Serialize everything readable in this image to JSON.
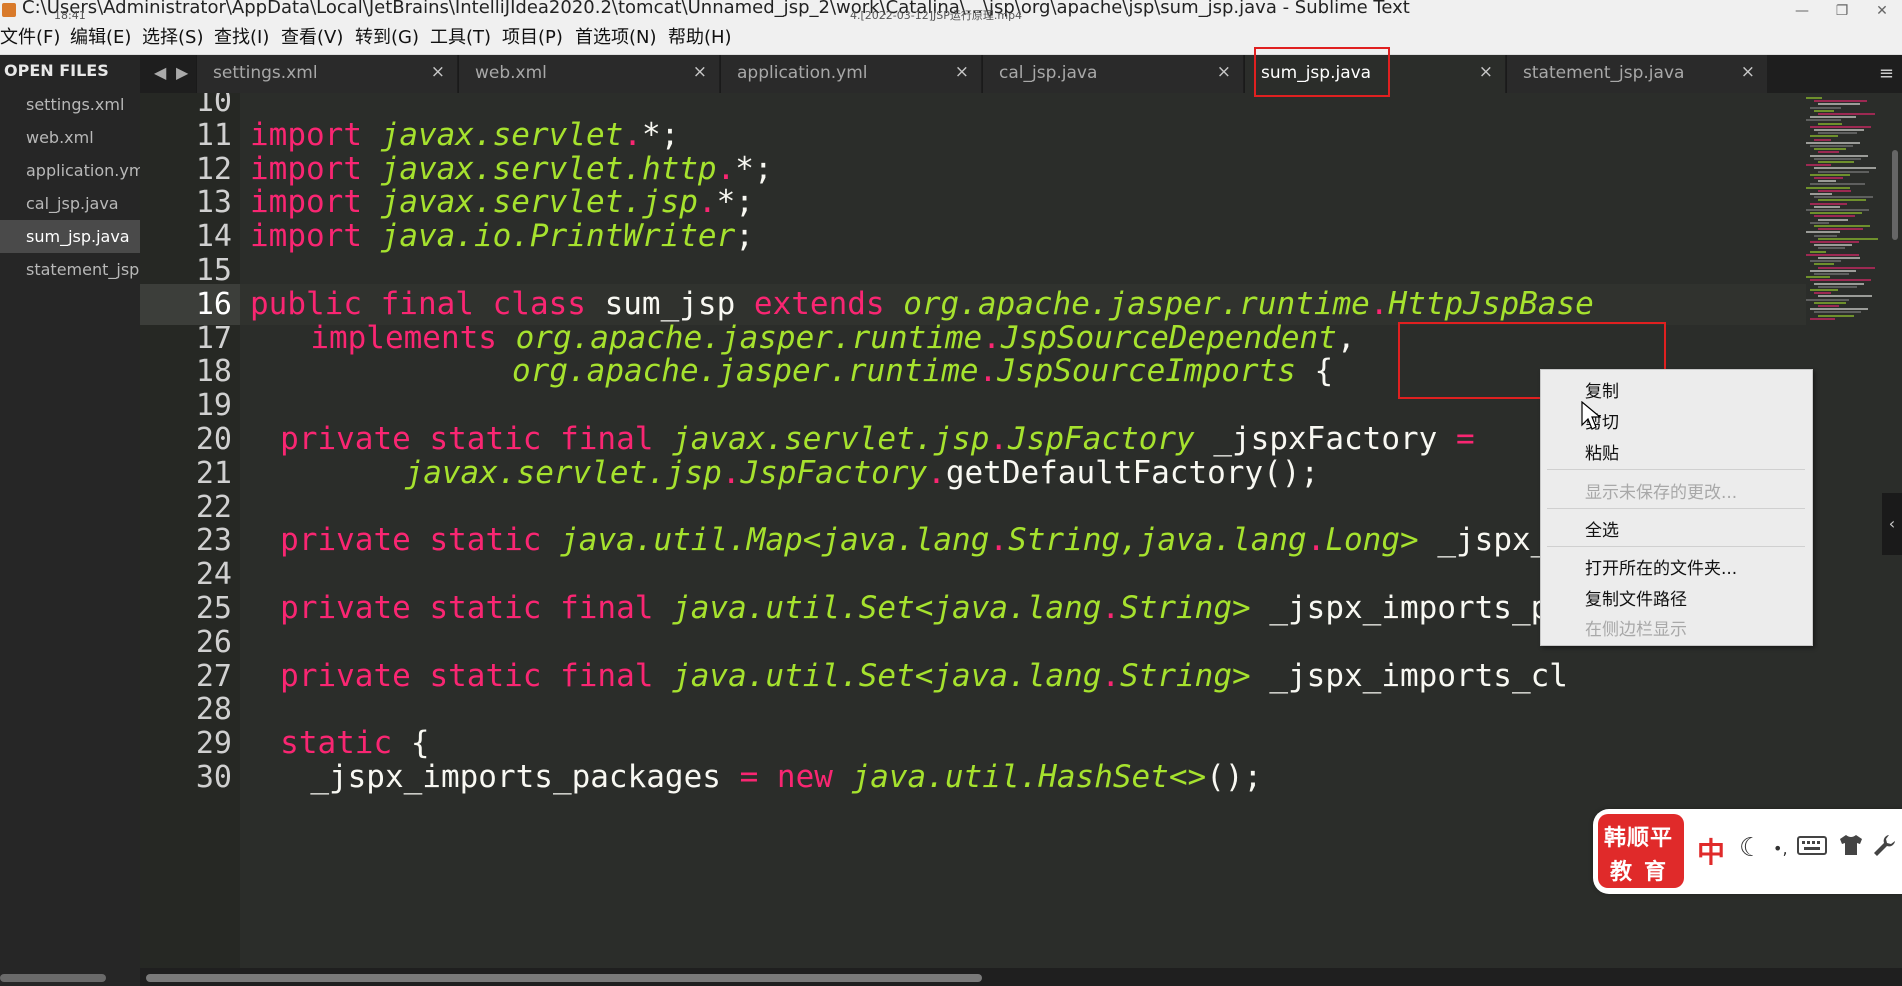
{
  "window": {
    "title": "C:\\Users\\Administrator\\AppData\\Local\\JetBrains\\IntelliJIdea2020.2\\tomcat\\Unnamed_jsp_2\\work\\Catalina\\...\\jsp\\org\\apache\\jsp\\sum_jsp.java - Sublime Text",
    "time_overlay": "18:41",
    "video_overlay": "4.[2022-03-12]JSP运行原理.mp4",
    "controls": [
      "—",
      "❐",
      "✕"
    ]
  },
  "menu": [
    {
      "label": "文件(F)"
    },
    {
      "label": "编辑(E)"
    },
    {
      "label": "选择(S)"
    },
    {
      "label": "查找(I)"
    },
    {
      "label": "查看(V)"
    },
    {
      "label": "转到(G)"
    },
    {
      "label": "工具(T)"
    },
    {
      "label": "项目(P)"
    },
    {
      "label": "首选项(N)"
    },
    {
      "label": "帮助(H)"
    }
  ],
  "sidebar": {
    "header": "OPEN FILES",
    "files": [
      {
        "label": "settings.xml",
        "selected": false
      },
      {
        "label": "web.xml",
        "selected": false
      },
      {
        "label": "application.yml",
        "selected": false
      },
      {
        "label": "cal_jsp.java",
        "selected": false
      },
      {
        "label": "sum_jsp.java",
        "selected": true
      },
      {
        "label": "statement_jsp.java",
        "selected": false
      }
    ]
  },
  "tabs": [
    {
      "label": "settings.xml",
      "close": "×",
      "active": false
    },
    {
      "label": "web.xml",
      "close": "×",
      "active": false
    },
    {
      "label": "application.yml",
      "close": "×",
      "active": false
    },
    {
      "label": "cal_jsp.java",
      "close": "×",
      "active": false
    },
    {
      "label": "sum_jsp.java",
      "close": "×",
      "active": true
    },
    {
      "label": "statement_jsp.java",
      "close": "×",
      "active": false
    }
  ],
  "tab_nav": {
    "prev": "◀",
    "next": "▶",
    "menu": "≡"
  },
  "editor": {
    "current_line": 16,
    "lines": [
      {
        "n": "10",
        "t": [],
        "indent": 0
      },
      {
        "n": "11",
        "t": [
          [
            "kw",
            "import "
          ],
          [
            "ty",
            "javax.servlet"
          ],
          [
            "op",
            "."
          ],
          [
            "pl",
            "*;"
          ]
        ],
        "indent": 0
      },
      {
        "n": "12",
        "t": [
          [
            "kw",
            "import "
          ],
          [
            "ty",
            "javax.servlet.http"
          ],
          [
            "op",
            "."
          ],
          [
            "pl",
            "*;"
          ]
        ],
        "indent": 0
      },
      {
        "n": "13",
        "t": [
          [
            "kw",
            "import "
          ],
          [
            "ty",
            "javax.servlet.jsp"
          ],
          [
            "op",
            "."
          ],
          [
            "pl",
            "*;"
          ]
        ],
        "indent": 0
      },
      {
        "n": "14",
        "t": [
          [
            "kw",
            "import "
          ],
          [
            "ty",
            "java.io.PrintWriter"
          ],
          [
            "pl",
            ";"
          ]
        ],
        "indent": 0
      },
      {
        "n": "15",
        "t": [],
        "indent": 0
      },
      {
        "n": "16",
        "t": [
          [
            "kw",
            "public final class "
          ],
          [
            "pl",
            "sum_jsp "
          ],
          [
            "kw",
            "extends "
          ],
          [
            "ty",
            "org.apache.jasper.runtime"
          ],
          [
            "op",
            "."
          ],
          [
            "ty",
            "HttpJspBase"
          ]
        ],
        "indent": 0
      },
      {
        "n": "17",
        "t": [
          [
            "kw",
            "implements "
          ],
          [
            "ty",
            "org.apache.jasper.runtime"
          ],
          [
            "op",
            "."
          ],
          [
            "ty",
            "JspSourceDependent"
          ],
          [
            "pl",
            ","
          ]
        ],
        "indent": 2
      },
      {
        "n": "18",
        "t": [
          [
            "ty",
            "org.apache.jasper.runtime"
          ],
          [
            "op",
            "."
          ],
          [
            "ty",
            "JspSourceImports "
          ],
          [
            "pl",
            "{"
          ]
        ],
        "indent": 8
      },
      {
        "n": "19",
        "t": [],
        "indent": 0
      },
      {
        "n": "20",
        "t": [
          [
            "kw",
            "private static final "
          ],
          [
            "ty",
            "javax.servlet.jsp"
          ],
          [
            "op",
            "."
          ],
          [
            "ty",
            "JspFactory "
          ],
          [
            "pl",
            "_jspxFactory "
          ],
          [
            "op",
            "="
          ]
        ],
        "indent": 1
      },
      {
        "n": "21",
        "t": [
          [
            "ty",
            "javax.servlet.jsp"
          ],
          [
            "op",
            "."
          ],
          [
            "ty",
            "JspFactory"
          ],
          [
            "op",
            "."
          ],
          [
            "pl",
            "getDefaultFactory();"
          ]
        ],
        "indent": 5
      },
      {
        "n": "22",
        "t": [],
        "indent": 0
      },
      {
        "n": "23",
        "t": [
          [
            "kw",
            "private static "
          ],
          [
            "ty",
            "java.util.Map<java.lang"
          ],
          [
            "op",
            "."
          ],
          [
            "ty",
            "String,java.lang"
          ],
          [
            "op",
            "."
          ],
          [
            "ty",
            "Long> "
          ],
          [
            "pl",
            "_jspx_dependants;"
          ]
        ],
        "indent": 1
      },
      {
        "n": "24",
        "t": [],
        "indent": 0
      },
      {
        "n": "25",
        "t": [
          [
            "kw",
            "private static final "
          ],
          [
            "ty",
            "java.util.Set<java.lang"
          ],
          [
            "op",
            "."
          ],
          [
            "ty",
            "String> "
          ],
          [
            "pl",
            "_jspx_imports_packages;"
          ]
        ],
        "indent": 1
      },
      {
        "n": "26",
        "t": [],
        "indent": 0
      },
      {
        "n": "27",
        "t": [
          [
            "kw",
            "private static final "
          ],
          [
            "ty",
            "java.util.Set<java.lang"
          ],
          [
            "op",
            "."
          ],
          [
            "ty",
            "String> "
          ],
          [
            "pl",
            "_jspx_imports_cl"
          ]
        ],
        "indent": 1
      },
      {
        "n": "28",
        "t": [],
        "indent": 0
      },
      {
        "n": "29",
        "t": [
          [
            "kw",
            "static "
          ],
          [
            "pl",
            "{"
          ]
        ],
        "indent": 1
      },
      {
        "n": "30",
        "t": [
          [
            "pl",
            "_jspx_imports_packages "
          ],
          [
            "op",
            "= "
          ],
          [
            "kw",
            "new "
          ],
          [
            "ty",
            "java.util.HashSet<>"
          ],
          [
            "pl",
            "();"
          ]
        ],
        "indent": 2
      }
    ]
  },
  "context_menu": [
    {
      "label": "复制",
      "enabled": true
    },
    {
      "label": "剪切",
      "enabled": true
    },
    {
      "label": "粘贴",
      "enabled": true
    },
    {
      "sep": true
    },
    {
      "label": "显示未保存的更改...",
      "enabled": false
    },
    {
      "sep": true
    },
    {
      "label": "全选",
      "enabled": true
    },
    {
      "sep": true
    },
    {
      "label": "打开所在的文件夹...",
      "enabled": true
    },
    {
      "label": "复制文件路径",
      "enabled": true
    },
    {
      "label": "在侧边栏显示",
      "enabled": false
    }
  ],
  "side_collapse": "‹",
  "watermark": {
    "brand_line1": "韩顺平",
    "brand_line2": "教育",
    "ime_label": "中",
    "icons": [
      "moon-icon",
      "keyboard-icon",
      "shirt-icon",
      "wrench-icon"
    ]
  },
  "colors": {
    "keyword": "#f92672",
    "type": "#a6e22e",
    "plain": "#f8f8f2",
    "annotation": "#e02020",
    "editor_bg": "#2b2d2a"
  }
}
